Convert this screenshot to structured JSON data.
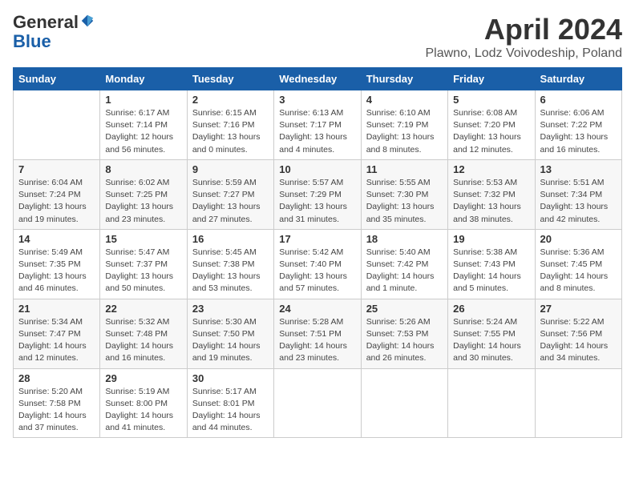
{
  "header": {
    "logo_line1": "General",
    "logo_line2": "Blue",
    "month_title": "April 2024",
    "subtitle": "Plawno, Lodz Voivodeship, Poland"
  },
  "weekdays": [
    "Sunday",
    "Monday",
    "Tuesday",
    "Wednesday",
    "Thursday",
    "Friday",
    "Saturday"
  ],
  "weeks": [
    [
      {
        "day": "",
        "info": ""
      },
      {
        "day": "1",
        "info": "Sunrise: 6:17 AM\nSunset: 7:14 PM\nDaylight: 12 hours\nand 56 minutes."
      },
      {
        "day": "2",
        "info": "Sunrise: 6:15 AM\nSunset: 7:16 PM\nDaylight: 13 hours\nand 0 minutes."
      },
      {
        "day": "3",
        "info": "Sunrise: 6:13 AM\nSunset: 7:17 PM\nDaylight: 13 hours\nand 4 minutes."
      },
      {
        "day": "4",
        "info": "Sunrise: 6:10 AM\nSunset: 7:19 PM\nDaylight: 13 hours\nand 8 minutes."
      },
      {
        "day": "5",
        "info": "Sunrise: 6:08 AM\nSunset: 7:20 PM\nDaylight: 13 hours\nand 12 minutes."
      },
      {
        "day": "6",
        "info": "Sunrise: 6:06 AM\nSunset: 7:22 PM\nDaylight: 13 hours\nand 16 minutes."
      }
    ],
    [
      {
        "day": "7",
        "info": "Sunrise: 6:04 AM\nSunset: 7:24 PM\nDaylight: 13 hours\nand 19 minutes."
      },
      {
        "day": "8",
        "info": "Sunrise: 6:02 AM\nSunset: 7:25 PM\nDaylight: 13 hours\nand 23 minutes."
      },
      {
        "day": "9",
        "info": "Sunrise: 5:59 AM\nSunset: 7:27 PM\nDaylight: 13 hours\nand 27 minutes."
      },
      {
        "day": "10",
        "info": "Sunrise: 5:57 AM\nSunset: 7:29 PM\nDaylight: 13 hours\nand 31 minutes."
      },
      {
        "day": "11",
        "info": "Sunrise: 5:55 AM\nSunset: 7:30 PM\nDaylight: 13 hours\nand 35 minutes."
      },
      {
        "day": "12",
        "info": "Sunrise: 5:53 AM\nSunset: 7:32 PM\nDaylight: 13 hours\nand 38 minutes."
      },
      {
        "day": "13",
        "info": "Sunrise: 5:51 AM\nSunset: 7:34 PM\nDaylight: 13 hours\nand 42 minutes."
      }
    ],
    [
      {
        "day": "14",
        "info": "Sunrise: 5:49 AM\nSunset: 7:35 PM\nDaylight: 13 hours\nand 46 minutes."
      },
      {
        "day": "15",
        "info": "Sunrise: 5:47 AM\nSunset: 7:37 PM\nDaylight: 13 hours\nand 50 minutes."
      },
      {
        "day": "16",
        "info": "Sunrise: 5:45 AM\nSunset: 7:38 PM\nDaylight: 13 hours\nand 53 minutes."
      },
      {
        "day": "17",
        "info": "Sunrise: 5:42 AM\nSunset: 7:40 PM\nDaylight: 13 hours\nand 57 minutes."
      },
      {
        "day": "18",
        "info": "Sunrise: 5:40 AM\nSunset: 7:42 PM\nDaylight: 14 hours\nand 1 minute."
      },
      {
        "day": "19",
        "info": "Sunrise: 5:38 AM\nSunset: 7:43 PM\nDaylight: 14 hours\nand 5 minutes."
      },
      {
        "day": "20",
        "info": "Sunrise: 5:36 AM\nSunset: 7:45 PM\nDaylight: 14 hours\nand 8 minutes."
      }
    ],
    [
      {
        "day": "21",
        "info": "Sunrise: 5:34 AM\nSunset: 7:47 PM\nDaylight: 14 hours\nand 12 minutes."
      },
      {
        "day": "22",
        "info": "Sunrise: 5:32 AM\nSunset: 7:48 PM\nDaylight: 14 hours\nand 16 minutes."
      },
      {
        "day": "23",
        "info": "Sunrise: 5:30 AM\nSunset: 7:50 PM\nDaylight: 14 hours\nand 19 minutes."
      },
      {
        "day": "24",
        "info": "Sunrise: 5:28 AM\nSunset: 7:51 PM\nDaylight: 14 hours\nand 23 minutes."
      },
      {
        "day": "25",
        "info": "Sunrise: 5:26 AM\nSunset: 7:53 PM\nDaylight: 14 hours\nand 26 minutes."
      },
      {
        "day": "26",
        "info": "Sunrise: 5:24 AM\nSunset: 7:55 PM\nDaylight: 14 hours\nand 30 minutes."
      },
      {
        "day": "27",
        "info": "Sunrise: 5:22 AM\nSunset: 7:56 PM\nDaylight: 14 hours\nand 34 minutes."
      }
    ],
    [
      {
        "day": "28",
        "info": "Sunrise: 5:20 AM\nSunset: 7:58 PM\nDaylight: 14 hours\nand 37 minutes."
      },
      {
        "day": "29",
        "info": "Sunrise: 5:19 AM\nSunset: 8:00 PM\nDaylight: 14 hours\nand 41 minutes."
      },
      {
        "day": "30",
        "info": "Sunrise: 5:17 AM\nSunset: 8:01 PM\nDaylight: 14 hours\nand 44 minutes."
      },
      {
        "day": "",
        "info": ""
      },
      {
        "day": "",
        "info": ""
      },
      {
        "day": "",
        "info": ""
      },
      {
        "day": "",
        "info": ""
      }
    ]
  ]
}
